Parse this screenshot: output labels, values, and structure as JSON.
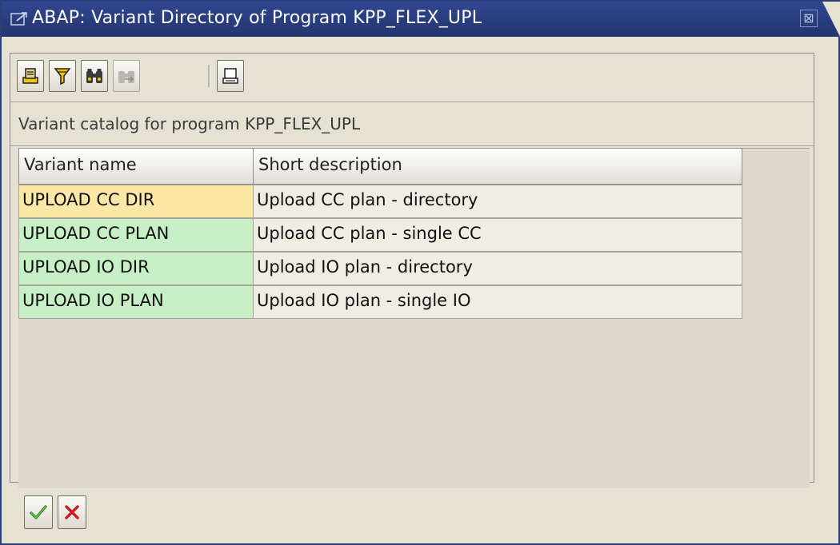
{
  "window": {
    "title": "ABAP: Variant Directory of Program KPP_FLEX_UPL",
    "close_glyph": "⊠"
  },
  "toolbar": {
    "buttons": [
      {
        "name": "print-icon"
      },
      {
        "name": "filter-icon"
      },
      {
        "name": "find-icon"
      },
      {
        "name": "find-next-icon",
        "disabled": true
      },
      {
        "name": "page-preview-icon"
      }
    ]
  },
  "catalog_label": "Variant catalog for program KPP_FLEX_UPL",
  "table": {
    "columns": [
      "Variant name",
      "Short description"
    ],
    "rows": [
      {
        "name": "UPLOAD CC DIR",
        "desc": "Upload CC plan -  directory",
        "selected": true
      },
      {
        "name": "UPLOAD CC PLAN",
        "desc": "Upload CC plan - single CC"
      },
      {
        "name": "UPLOAD IO DIR",
        "desc": "Upload IO plan -  directory"
      },
      {
        "name": "UPLOAD IO PLAN",
        "desc": "Upload IO plan - single IO"
      }
    ]
  },
  "footer": {
    "buttons": [
      {
        "name": "confirm-checkmark-icon"
      },
      {
        "name": "cancel-x-icon"
      }
    ]
  },
  "colors": {
    "title_bar": "#31468f",
    "selected_cell": "#fde7a6",
    "key_cell": "#c8f0c6",
    "background": "#e6e2d3"
  }
}
